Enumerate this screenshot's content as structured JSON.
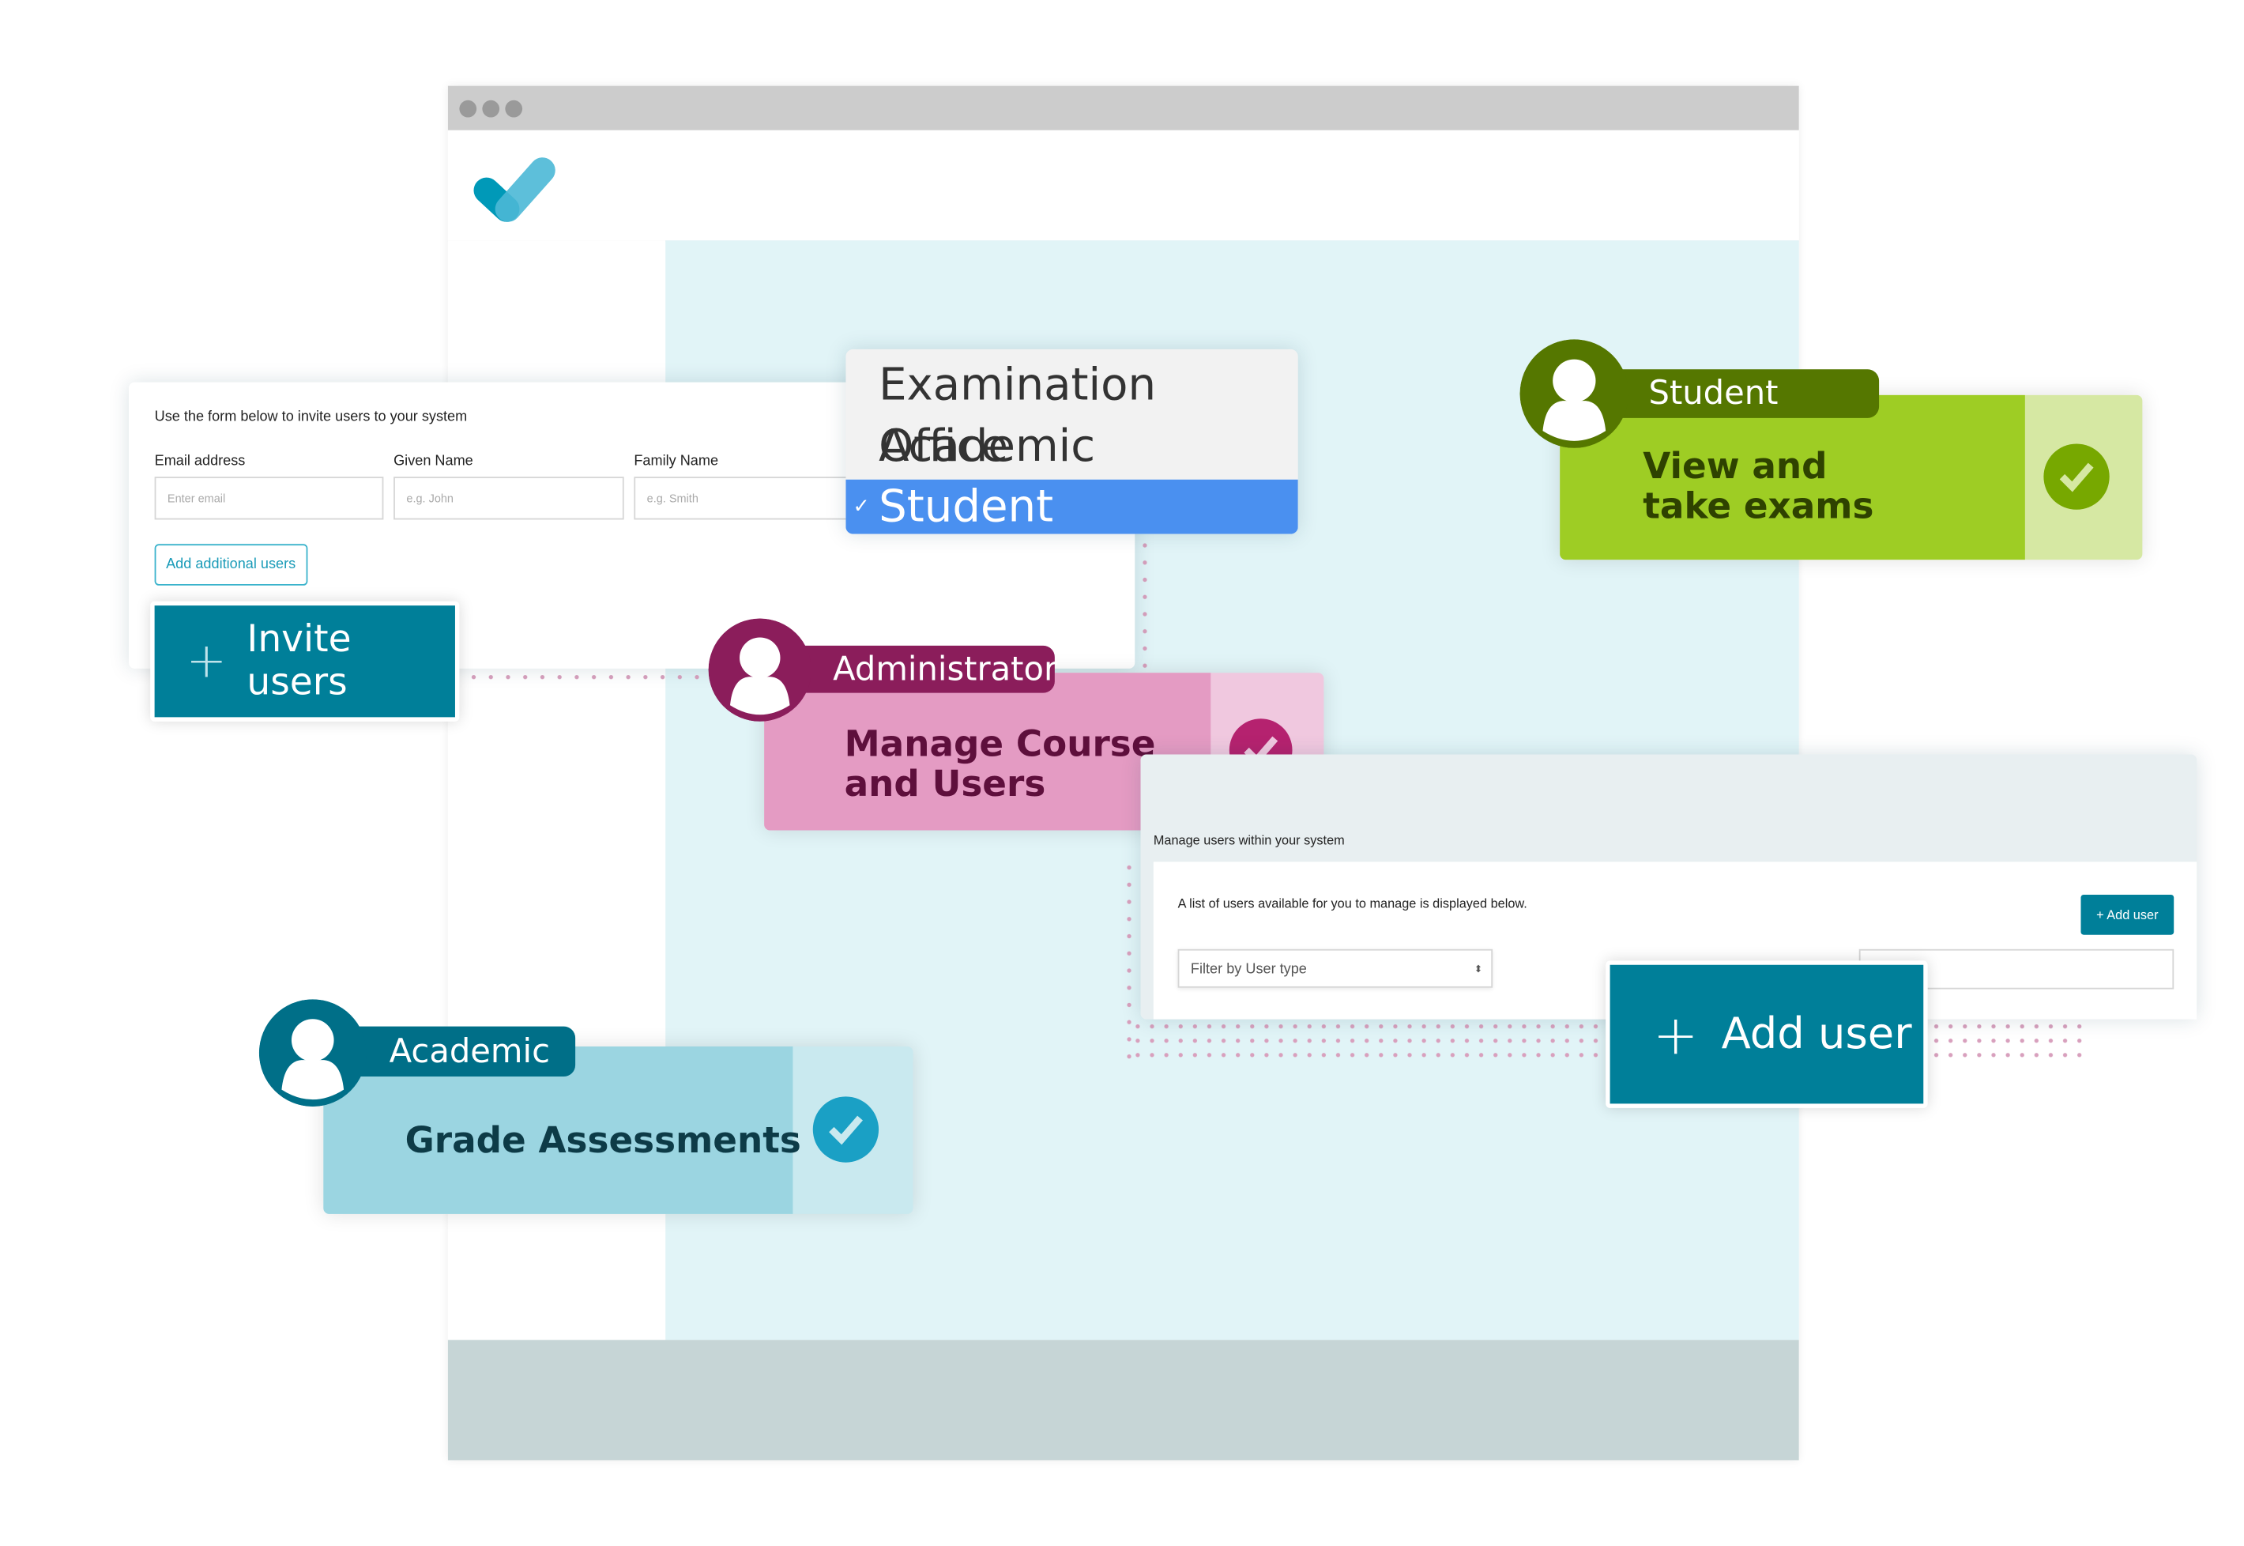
{
  "window": {
    "dots": [
      "close",
      "minimize",
      "maximize"
    ],
    "logo": "checkmark-logo"
  },
  "invite_form": {
    "intro": "Use the form below to invite users to your system",
    "fields": [
      {
        "label": "Email address",
        "placeholder": "Enter email"
      },
      {
        "label": "Given Name",
        "placeholder": "e.g. John"
      },
      {
        "label": "Family Name",
        "placeholder": "e.g. Smith"
      }
    ],
    "add_additional": "Add additional users"
  },
  "invite_button": {
    "icon": "plus-icon",
    "label": "Invite users"
  },
  "role_dropdown": {
    "options": [
      "Examination Office",
      "Academic",
      "Student"
    ],
    "selected": "Student",
    "check": "✓"
  },
  "roles": {
    "student": {
      "label": "Student",
      "text": "View and\ntake exams",
      "color": "#9ecd24",
      "dark": "#557700"
    },
    "administrator": {
      "label": "Administrator",
      "text": "Manage Course\nand Users",
      "color": "#e49bc3",
      "dark": "#8b1d5b"
    },
    "academic": {
      "label": "Academic",
      "text": "Grade Assessments",
      "color": "#9bd5e1",
      "dark": "#006f88"
    }
  },
  "manage_users": {
    "heading": "Manage users within your system",
    "intro": "A list of users available for you to manage is displayed below.",
    "add_user_small": "+ Add user",
    "filter_placeholder": "Filter by User type"
  },
  "add_user_button": {
    "icon": "plus-icon",
    "label": "Add user"
  }
}
